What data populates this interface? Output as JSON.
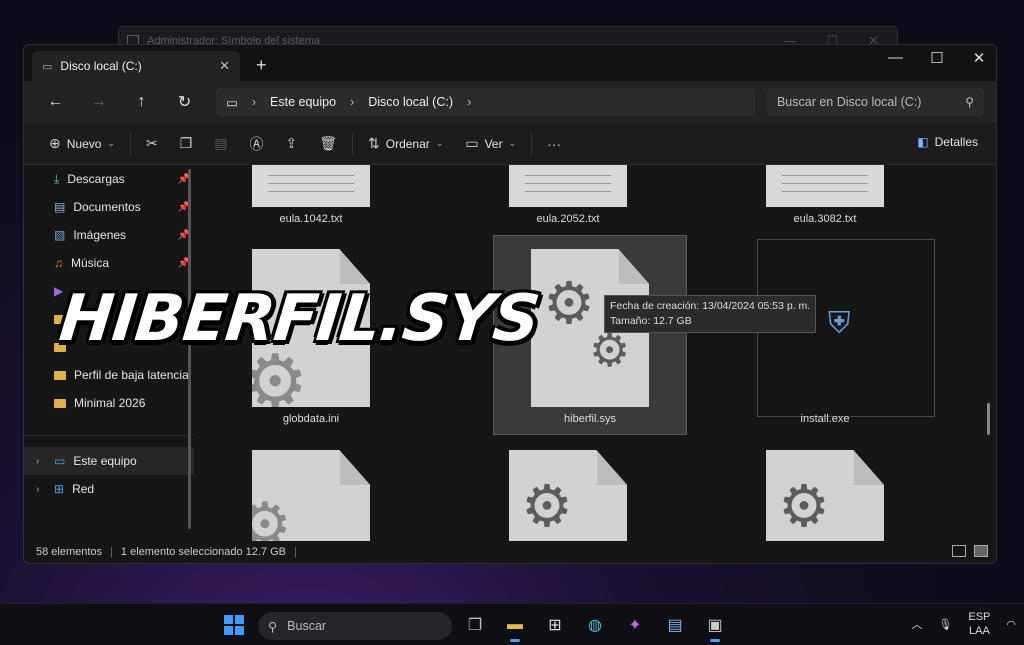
{
  "background_window": {
    "title": "Administrador: Símbolo del sistema"
  },
  "explorer": {
    "tab_title": "Disco local (C:)",
    "breadcrumb": [
      "Este equipo",
      "Disco local (C:)"
    ],
    "search_placeholder": "Buscar en Disco local (C:)",
    "toolbar": {
      "new_label": "Nuevo",
      "sort_label": "Ordenar",
      "view_label": "Ver",
      "more_label": "···",
      "details_label": "Detalles"
    },
    "sidebar": {
      "quick": [
        {
          "label": "Descargas",
          "icon": "download-icon"
        },
        {
          "label": "Documentos",
          "icon": "document-icon"
        },
        {
          "label": "Imágenes",
          "icon": "image-icon"
        },
        {
          "label": "Música",
          "icon": "music-icon"
        }
      ],
      "folders": [
        "Perfil de baja latencia",
        "Minimal 2026"
      ],
      "drives": [
        "Este equipo",
        "Red"
      ]
    },
    "files": {
      "row1": [
        "eula.1042.txt",
        "eula.2052.txt",
        "eula.3082.txt"
      ],
      "row2": [
        "globdata.ini",
        "hiberfil.sys",
        "install.exe"
      ]
    },
    "tooltip": {
      "created": "Fecha de creación: 13/04/2024 05:53 p. m.",
      "size": "Tamaño: 12.7 GB"
    },
    "status": {
      "count": "58 elementos",
      "selected": "1 elemento seleccionado  12.7 GB"
    }
  },
  "overlay_title": "HIBERFIL.SYS",
  "taskbar": {
    "search_label": "Buscar",
    "lang_top": "ESP",
    "lang_bottom": "LAA"
  },
  "colors": {
    "accent": "#3b9cff",
    "folder": "#e0b34a"
  }
}
